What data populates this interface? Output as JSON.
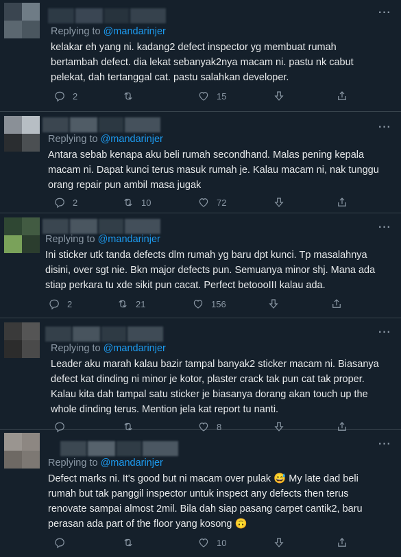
{
  "tweets": [
    {
      "reply_prefix": "Replying to",
      "reply_handle": "@mandarinjer",
      "lines": [
        "kelakar eh yang ni. kadang2 defect inspector yg membuat rumah",
        "bertambah defect. dia lekat sebanyak2nya macam ni. pastu nk cabut",
        "pelekat, dah tertanggal cat. pastu salahkan developer."
      ],
      "reply_count": "2",
      "retweet_count": "",
      "like_count": "15",
      "avatar_colors": [
        "#3a4550",
        "#6f7c86",
        "#5b6770",
        "#4a565f"
      ],
      "name_colors": [
        "#2d3a45",
        "#3a4653",
        "#27333d",
        "#36424d"
      ]
    },
    {
      "reply_prefix": "Replying to",
      "reply_handle": "@mandarinjer",
      "lines": [
        "Antara sebab kenapa aku beli rumah secondhand. Malas pening kepala",
        "macam ni. Dapat kunci terus masuk rumah je. Kalau macam ni, nak tunggu",
        "orang repair pun ambil masa jugak"
      ],
      "reply_count": "2",
      "retweet_count": "10",
      "like_count": "72",
      "avatar_colors": [
        "#8a9097",
        "#b7bec4",
        "#2a2d30",
        "#4b4f52"
      ],
      "name_colors": [
        "#3b4650",
        "#505c66",
        "#2c3842",
        "#45515c"
      ]
    },
    {
      "reply_prefix": "Replying to",
      "reply_handle": "@mandarinjer",
      "lines": [
        "Ini sticker utk tanda defects dlm rumah yg baru dpt kunci. Tp masalahnya",
        "disini, over sgt nie. Bkn major defects pun. Semuanya minor shj. Mana ada",
        "stiap perkara tu xde sikit pun cacat. Perfect betoooIII kalau ada."
      ],
      "reply_count": "2",
      "retweet_count": "21",
      "like_count": "156",
      "avatar_colors": [
        "#2f4733",
        "#425b42",
        "#7aa25a",
        "#2b3d2e"
      ],
      "name_colors": [
        "#3a4650",
        "#4a5660",
        "#323e48",
        "#434f5a"
      ]
    },
    {
      "reply_prefix": "Replying to",
      "reply_handle": "@mandarinjer",
      "lines": [
        "Leader aku marah kalau bazir tampal banyak2 sticker macam ni. Biasanya",
        "defect kat dinding ni minor je kotor, plaster crack tak pun cat tak proper.",
        "Kalau kita dah tampal satu sticker je biasanya dorang akan touch up the",
        "whole dinding terus. Mention jela kat report tu nanti."
      ],
      "reply_count": "",
      "retweet_count": "",
      "like_count": "8",
      "avatar_colors": [
        "#3a3a3a",
        "#555555",
        "#2c2c2c",
        "#4a4a4a"
      ],
      "name_colors": [
        "#34404a",
        "#48545e",
        "#2e3a44",
        "#3f4b56"
      ]
    },
    {
      "reply_prefix": "Replying to",
      "reply_handle": "@mandarinjer",
      "lines": [
        "Defect marks ni. It's good but ni macam over pulak 😅 My late dad beli",
        "rumah but tak panggil inspector untuk inspect any defects then terus",
        "renovate sampai almost 2mil. Bila dah siap pasang carpet cantik2, baru",
        "perasan ada part of the floor yang kosong 🙃"
      ],
      "reply_count": "",
      "retweet_count": "",
      "like_count": "10",
      "avatar_colors": [
        "#9a9590",
        "#8d8782",
        "#6e6964",
        "#7d7873"
      ],
      "name_colors": [
        "#3c4852",
        "#56626c",
        "#303c46",
        "#4b5762"
      ]
    }
  ],
  "colors": {
    "background": "#15202b",
    "text": "#e7e9ea",
    "muted": "#8b98a5",
    "link": "#1d9bf0",
    "divider": "#38444d"
  }
}
